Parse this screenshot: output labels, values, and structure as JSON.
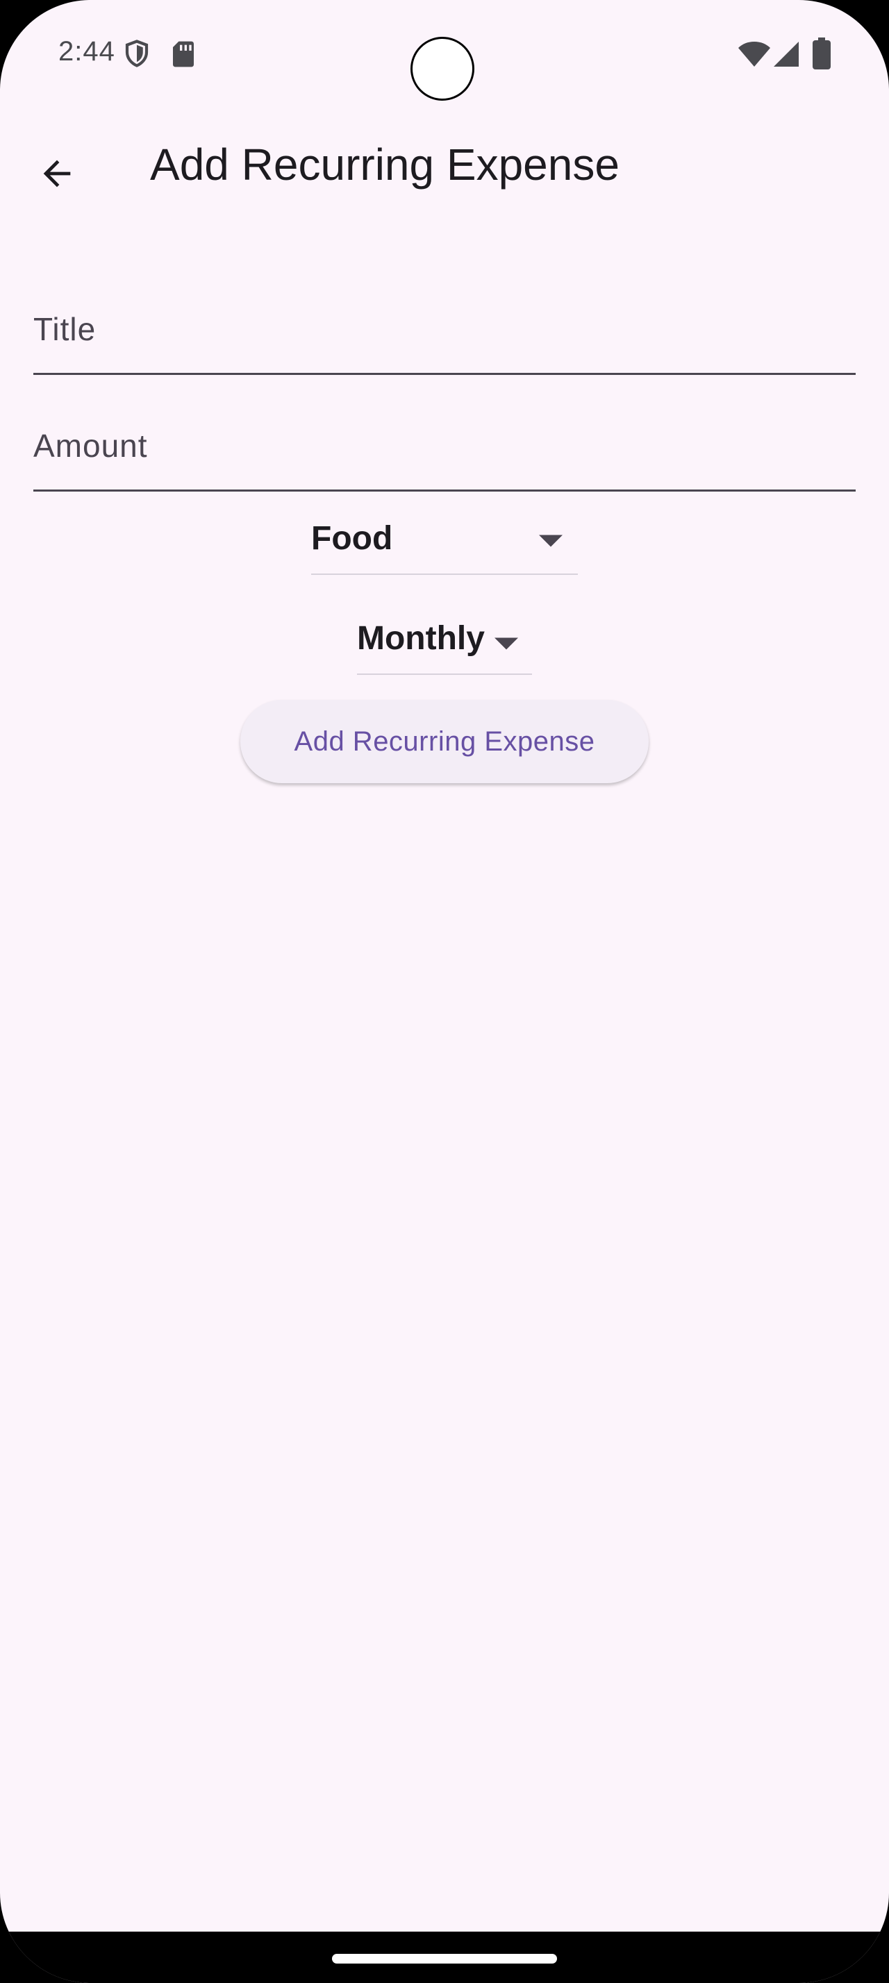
{
  "status_bar": {
    "time": "2:44",
    "icons": [
      "shield-icon",
      "sd-card-icon",
      "wifi-icon",
      "signal-icon",
      "battery-icon"
    ]
  },
  "app_bar": {
    "back_icon": "arrow-back-icon",
    "title": "Add Recurring Expense"
  },
  "form": {
    "title_field": {
      "value": "",
      "placeholder": "Title"
    },
    "amount_field": {
      "value": "",
      "placeholder": "Amount"
    },
    "category_dropdown": {
      "selected": "Food"
    },
    "frequency_dropdown": {
      "selected": "Monthly"
    },
    "submit_label": "Add Recurring Expense"
  },
  "colors": {
    "background": "#fcf4fb",
    "accent": "#6750a4",
    "button_bg": "#f3edf6",
    "text_primary": "#1d1b20",
    "text_secondary": "#4a4550"
  }
}
